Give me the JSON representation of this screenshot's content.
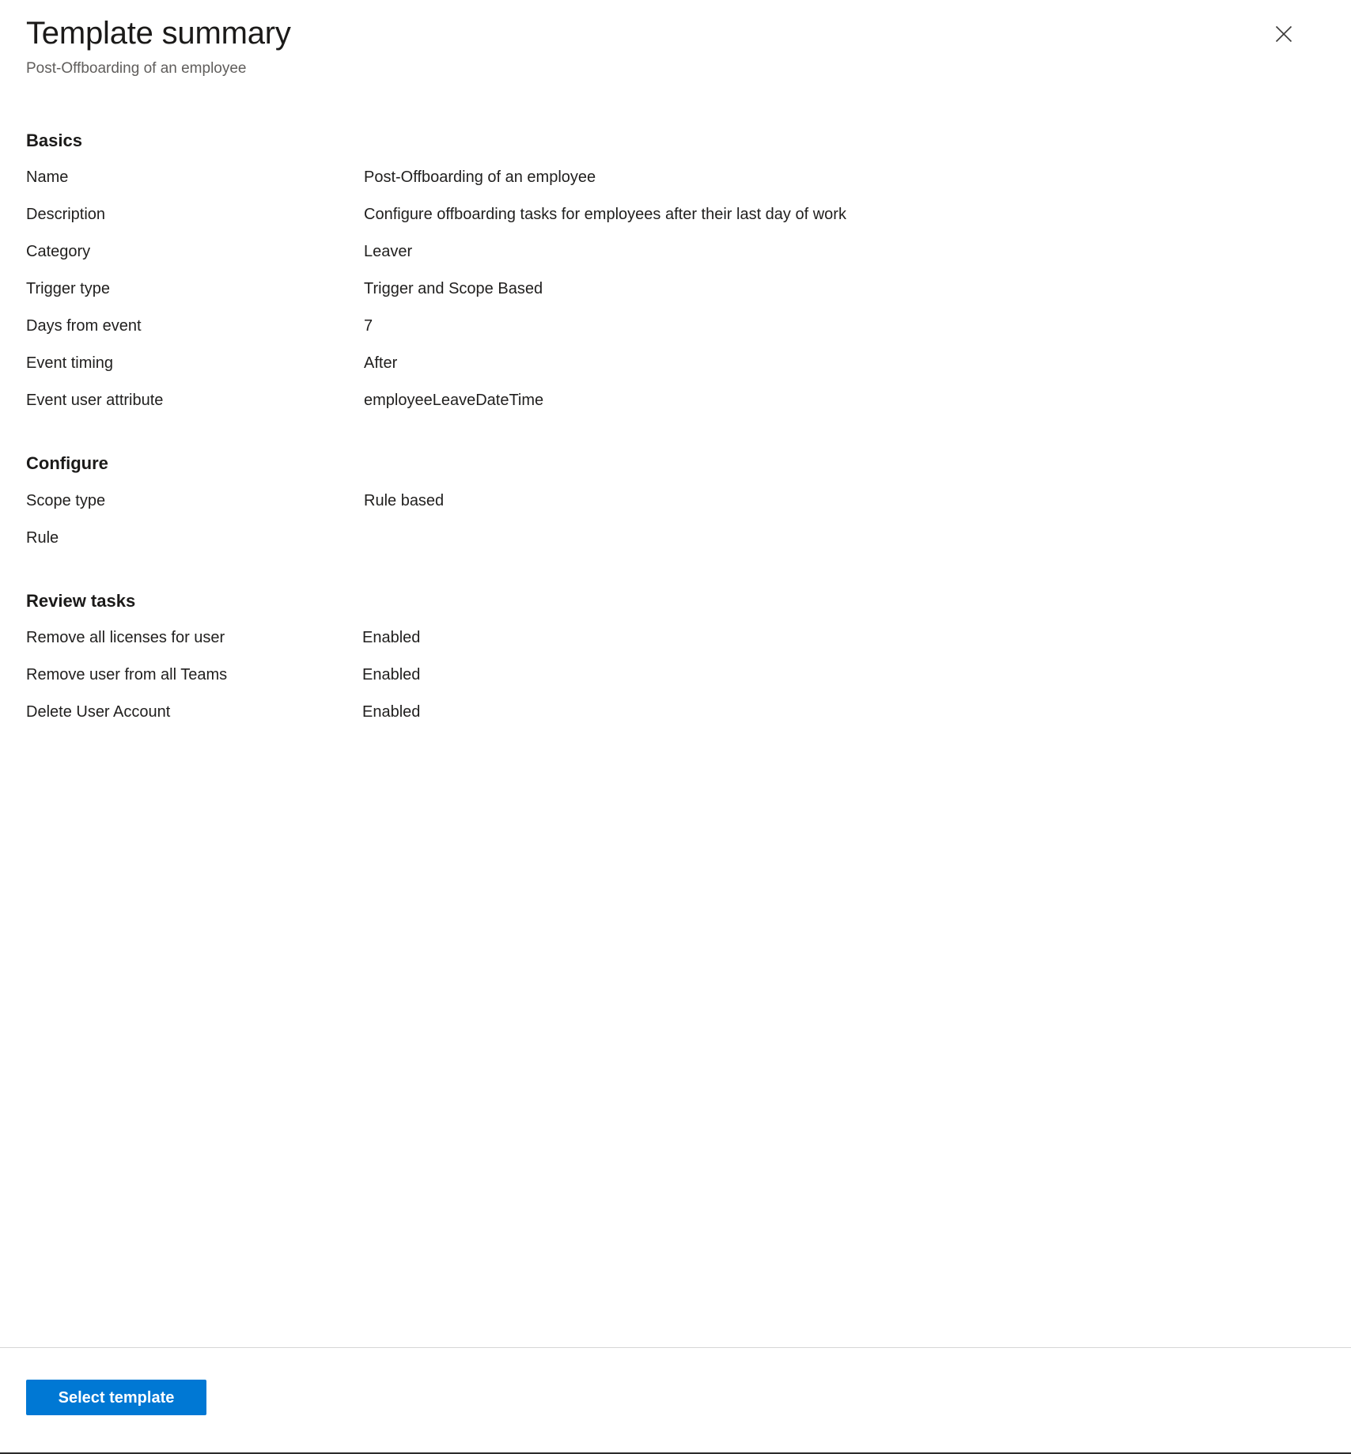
{
  "header": {
    "title": "Template summary",
    "subtitle": "Post-Offboarding of an employee",
    "close_icon": "close-icon"
  },
  "sections": [
    {
      "heading": "Basics",
      "rows": [
        {
          "label": "Name",
          "value": "Post-Offboarding of an employee"
        },
        {
          "label": "Description",
          "value": "Configure offboarding tasks for employees after their last day of work"
        },
        {
          "label": "Category",
          "value": "Leaver"
        },
        {
          "label": "Trigger type",
          "value": "Trigger and Scope Based"
        },
        {
          "label": "Days from event",
          "value": "7"
        },
        {
          "label": "Event timing",
          "value": "After"
        },
        {
          "label": "Event user attribute",
          "value": "employeeLeaveDateTime"
        }
      ]
    },
    {
      "heading": "Configure",
      "rows": [
        {
          "label": "Scope type",
          "value": "Rule based"
        },
        {
          "label": "Rule",
          "value": ""
        }
      ]
    },
    {
      "heading": "Review tasks",
      "rows": [
        {
          "label": "Remove all licenses for user",
          "value": "Enabled"
        },
        {
          "label": "Remove user from all Teams",
          "value": "Enabled"
        },
        {
          "label": "Delete User Account",
          "value": "Enabled"
        }
      ]
    }
  ],
  "footer": {
    "primary_button_label": "Select template"
  },
  "colors": {
    "accent": "#0078d4",
    "text_primary": "#201f1e",
    "text_secondary": "#605e5c",
    "divider": "#d6d6d6",
    "background": "#ffffff"
  }
}
